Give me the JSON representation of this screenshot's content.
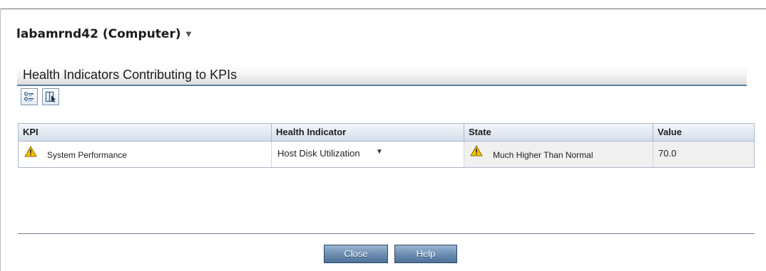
{
  "header": {
    "title": "labamrnd42 (Computer)",
    "title_menu_icon": "caret-down-icon"
  },
  "section": {
    "title": "Health Indicators Contributing to KPIs"
  },
  "toolbar": [
    {
      "icon": "list-view-icon"
    },
    {
      "icon": "select-columns-icon"
    }
  ],
  "table": {
    "columns": [
      "KPI",
      "Health Indicator",
      "State",
      "Value"
    ],
    "rows": [
      {
        "kpi": "System Performance",
        "kpi_icon": "warning-icon",
        "health_indicator": "Host Disk Utilization",
        "state": "Much Higher Than Normal",
        "state_icon": "warning-icon",
        "value": "70.0"
      }
    ]
  },
  "footer": {
    "close_label": "Close",
    "help_label": "Help"
  },
  "colors": {
    "accent": "#5f7f9e",
    "button": "#6d8fb3",
    "warning": "#f2c200"
  }
}
